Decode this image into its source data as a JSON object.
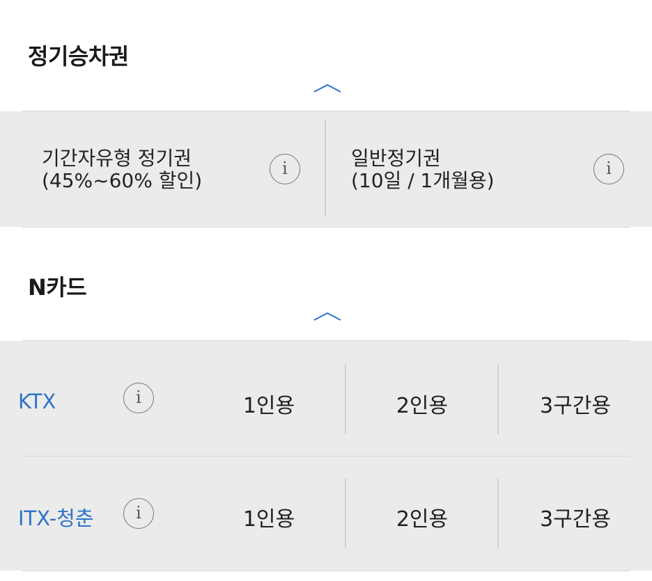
{
  "season_pass": {
    "title": "정기승차권",
    "options": [
      {
        "line1": "기간자유형 정기권",
        "line2": "(45%~60% 할인)",
        "info_icon": "info-icon"
      },
      {
        "line1": "일반정기권",
        "line2": "(10일 / 1개월용)",
        "info_icon": "info-icon"
      }
    ]
  },
  "n_card": {
    "title": "N카드",
    "rows": [
      {
        "name": "KTX",
        "info_icon": "info-icon",
        "opt1": "1인용",
        "opt2": "2인용",
        "opt3": "3구간용"
      },
      {
        "name": "ITX-청춘",
        "info_icon": "info-icon",
        "opt1": "1인용",
        "opt2": "2인용",
        "opt3": "3구간용"
      }
    ]
  },
  "info_glyph": "i",
  "colors": {
    "accent": "#2e73c8",
    "panel": "#ebebeb",
    "text": "#222222"
  }
}
